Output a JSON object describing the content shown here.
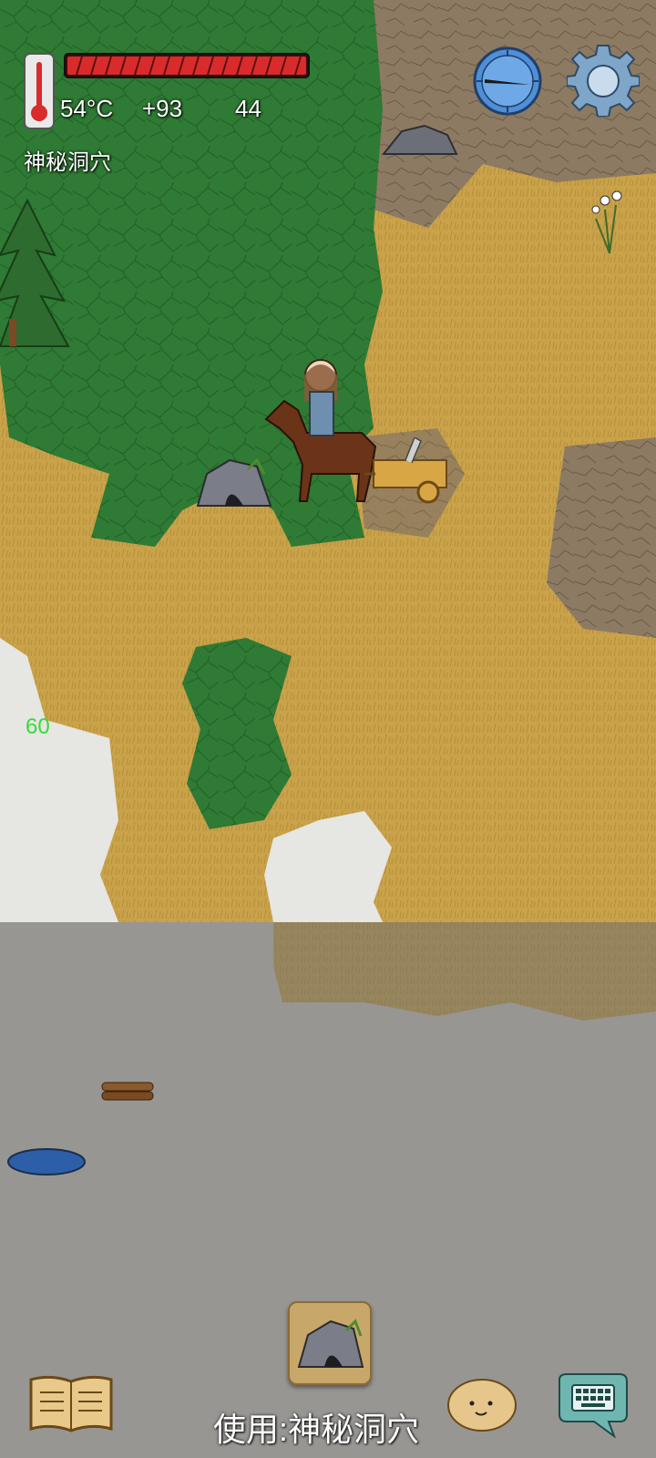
{
  "hud": {
    "temperature": "54°C",
    "bonus": "+93",
    "count": "44",
    "location": "神秘洞穴",
    "health_fraction": 1.0
  },
  "debug": {
    "fps": "60"
  },
  "action": {
    "use_label": "使用:神秘洞穴",
    "item_icon": "mysterious-cave-icon"
  },
  "icons": {
    "thermometer": "thermometer-icon",
    "compass": "compass-icon",
    "settings": "gear-icon",
    "journal": "open-book-icon",
    "companion": "potato-face-icon",
    "chat": "keyboard-speech-bubble-icon"
  },
  "colors": {
    "health_bar": "#d92b2b",
    "forest": "#2f7a34",
    "grass": "#c9a24a",
    "dirt": "#8c7a62",
    "snow": "#e6e6e2",
    "fps": "#3bd83b"
  }
}
